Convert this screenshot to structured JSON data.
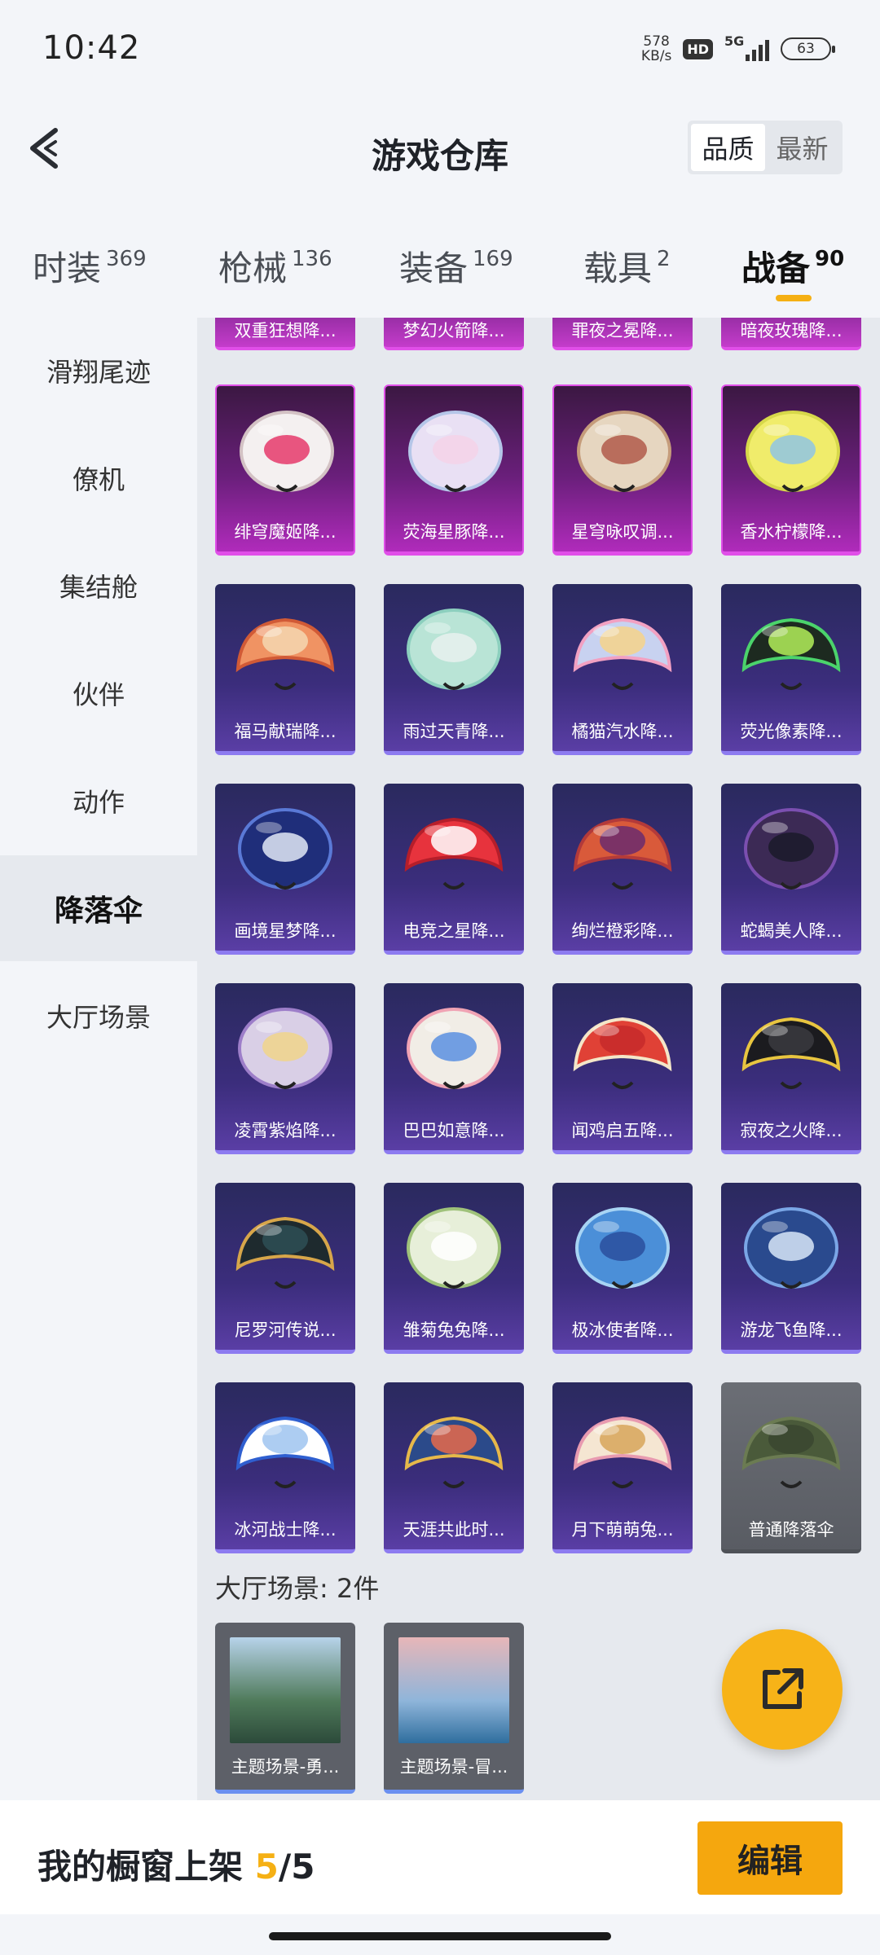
{
  "status": {
    "time": "10:42",
    "net_speed": "578",
    "net_unit": "KB/s",
    "hd": "HD",
    "network": "5G",
    "battery": "63"
  },
  "header": {
    "title": "游戏仓库",
    "sort_quality": "品质",
    "sort_latest": "最新"
  },
  "tabs": [
    {
      "label": "时装",
      "count": "369"
    },
    {
      "label": "枪械",
      "count": "136"
    },
    {
      "label": "装备",
      "count": "169"
    },
    {
      "label": "载具",
      "count": "2"
    },
    {
      "label": "战备",
      "count": "90"
    }
  ],
  "sidebar": [
    {
      "label": "滑翔尾迹"
    },
    {
      "label": "僚机"
    },
    {
      "label": "集结舱"
    },
    {
      "label": "伙伴"
    },
    {
      "label": "动作"
    },
    {
      "label": "降落伞"
    },
    {
      "label": "大厅场景"
    }
  ],
  "top_partial_items": [
    "双重狂想降...",
    "梦幻火箭降...",
    "罪夜之冕降...",
    "暗夜玫瑰降..."
  ],
  "parachutes": [
    {
      "label": "绯穹魔姬降...",
      "rarity": "legendary",
      "colors": [
        "#f4f0f0",
        "#d3c2c4",
        "#e5396b"
      ]
    },
    {
      "label": "荧海星豚降...",
      "rarity": "legendary",
      "colors": [
        "#e9e0f4",
        "#b5c6e8",
        "#f5d2e8"
      ]
    },
    {
      "label": "星穹咏叹调...",
      "rarity": "legendary",
      "colors": [
        "#e6d6c0",
        "#c59c7b",
        "#b05a4a"
      ]
    },
    {
      "label": "香水柠檬降...",
      "rarity": "legendary",
      "colors": [
        "#f0ec6b",
        "#d7d84a",
        "#8fc6e4"
      ]
    },
    {
      "label": "福马献瑞降...",
      "rarity": "epic",
      "colors": [
        "#f09363",
        "#d15a36",
        "#f4d7b0"
      ]
    },
    {
      "label": "雨过天青降...",
      "rarity": "epic",
      "colors": [
        "#b9e4d6",
        "#8ccfbe",
        "#e8f1ee"
      ]
    },
    {
      "label": "橘猫汽水降...",
      "rarity": "epic",
      "colors": [
        "#c8d2f0",
        "#f2a1c2",
        "#f6d38a"
      ]
    },
    {
      "label": "荧光像素降...",
      "rarity": "epic",
      "colors": [
        "#1d2a20",
        "#4bd36b",
        "#b3f05a"
      ]
    },
    {
      "label": "画境星梦降...",
      "rarity": "epic",
      "colors": [
        "#1f2e7a",
        "#5a79d6",
        "#e2e8f6"
      ]
    },
    {
      "label": "电竞之星降...",
      "rarity": "epic",
      "colors": [
        "#e7333d",
        "#b51e2a",
        "#ffffff"
      ]
    },
    {
      "label": "绚烂橙彩降...",
      "rarity": "epic",
      "colors": [
        "#d95a3a",
        "#b33a3a",
        "#6a2b6e"
      ]
    },
    {
      "label": "蛇蝎美人降...",
      "rarity": "epic",
      "colors": [
        "#3c2a55",
        "#7b4fb0",
        "#1a1a2a"
      ]
    },
    {
      "label": "凌霄紫焰降...",
      "rarity": "epic",
      "colors": [
        "#d9cfe6",
        "#9d7ec9",
        "#f0d58a"
      ]
    },
    {
      "label": "巴巴如意降...",
      "rarity": "epic",
      "colors": [
        "#f1ede6",
        "#f0a3b4",
        "#5b8fe0"
      ]
    },
    {
      "label": "闻鸡启五降...",
      "rarity": "epic",
      "colors": [
        "#e04136",
        "#f4e6c8",
        "#c62a2a"
      ]
    },
    {
      "label": "寂夜之火降...",
      "rarity": "epic",
      "colors": [
        "#1b1b1f",
        "#e8c540",
        "#3a3a40"
      ]
    },
    {
      "label": "尼罗河传说...",
      "rarity": "epic",
      "colors": [
        "#1e2a2e",
        "#d7a64a",
        "#2e4f55"
      ]
    },
    {
      "label": "雏菊兔兔降...",
      "rarity": "epic",
      "colors": [
        "#e7efd9",
        "#9fc27a",
        "#ffffff"
      ]
    },
    {
      "label": "极冰使者降...",
      "rarity": "epic",
      "colors": [
        "#4b8fd8",
        "#a8d4f4",
        "#2a4f9e"
      ]
    },
    {
      "label": "游龙飞鱼降...",
      "rarity": "epic",
      "colors": [
        "#2a4a8e",
        "#7aa6e6",
        "#d8e6f8"
      ]
    },
    {
      "label": "冰河战士降...",
      "rarity": "epic",
      "colors": [
        "#ffffff",
        "#2f5fd0",
        "#9fc4f0"
      ]
    },
    {
      "label": "天涯共此时...",
      "rarity": "epic",
      "colors": [
        "#2b4a8a",
        "#e6b84a",
        "#e86a4a"
      ]
    },
    {
      "label": "月下萌萌兔...",
      "rarity": "epic",
      "colors": [
        "#f5e6d2",
        "#e89ab0",
        "#d7a45a"
      ]
    },
    {
      "label": "普通降落伞",
      "rarity": "common",
      "colors": [
        "#4a5a3a",
        "#6b7b52",
        "#3a4630"
      ]
    }
  ],
  "scene_section": {
    "title": "大厅场景: 2件",
    "items": [
      {
        "label": "主题场景-勇...",
        "colors": [
          "#b7d3ea",
          "#4f7a5a",
          "#2c4a3a"
        ]
      },
      {
        "label": "主题场景-冒...",
        "colors": [
          "#e7b6b8",
          "#8fb5da",
          "#2f6e9e"
        ]
      }
    ]
  },
  "bottom": {
    "shelf_label": "我的橱窗上架",
    "shelf_current": "5",
    "shelf_total": "/5",
    "edit_label": "编辑"
  }
}
